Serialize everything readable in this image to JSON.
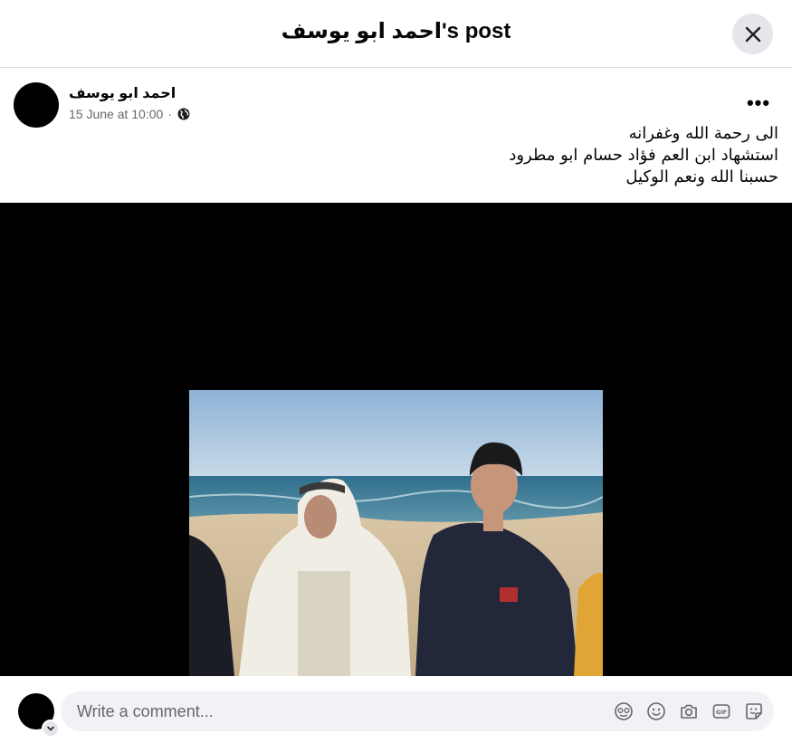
{
  "header": {
    "title": "احمد ابو يوسف's post",
    "close_icon": "close-icon"
  },
  "post": {
    "author": "احمد ابو يوسف",
    "timestamp": "15 June at 10:00",
    "separator": "·",
    "privacy_icon": "globe-icon",
    "more_icon": "more-options-icon",
    "more_label": "•••",
    "text_lines": [
      "الى رحمة الله وغفرانه",
      "استشهاد ابن العم فؤاد حسام ابو مطرود",
      "حسبنا الله ونعم الوكيل"
    ]
  },
  "comment": {
    "placeholder": "Write a comment...",
    "icons": [
      "avatar-sticker-icon",
      "emoji-icon",
      "camera-icon",
      "gif-icon",
      "sticker-icon"
    ]
  },
  "colors": {
    "background": "#ffffff",
    "input_bg": "#f0f2f5",
    "secondary_text": "#65676b",
    "close_bg": "#e4e6eb"
  }
}
